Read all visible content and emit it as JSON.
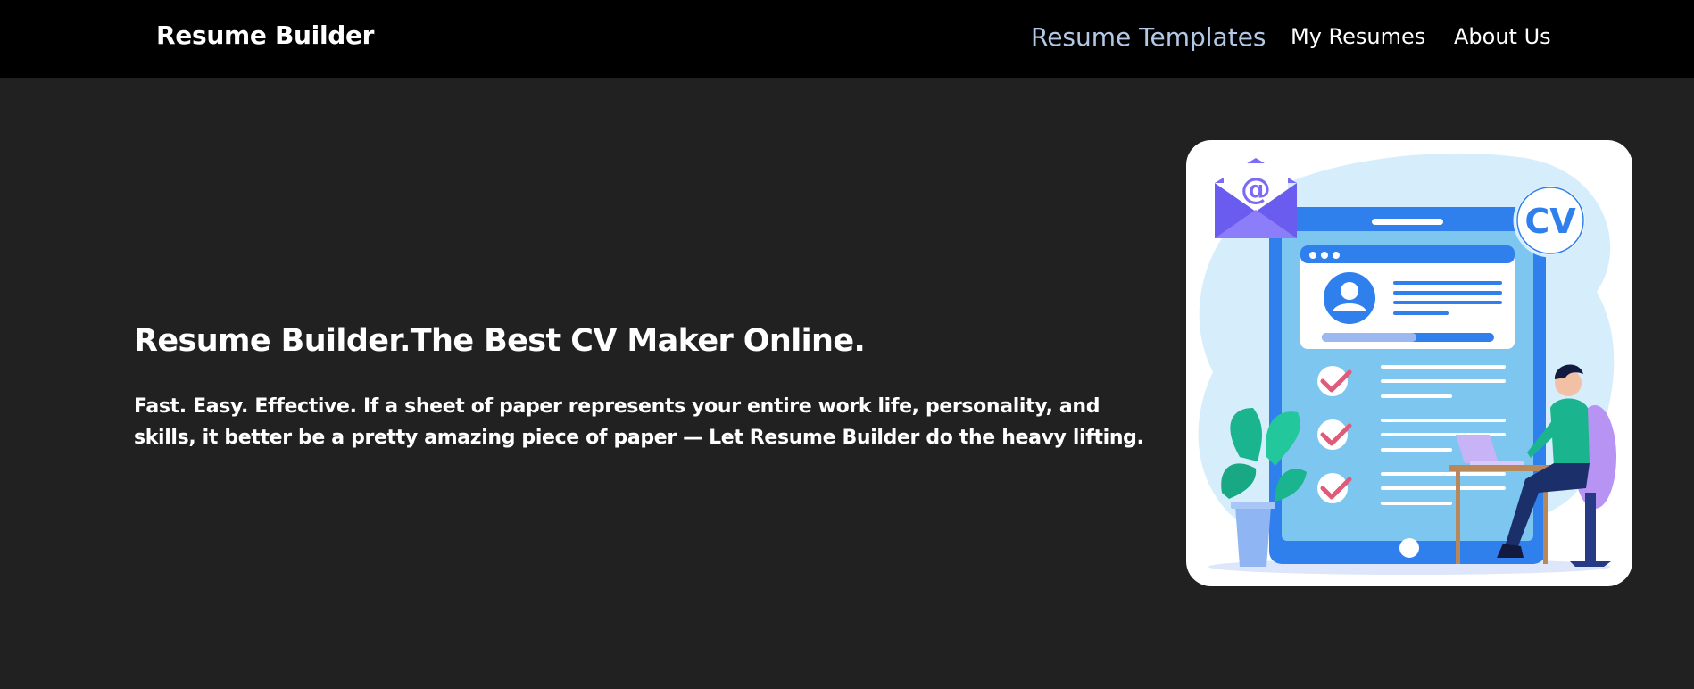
{
  "header": {
    "brand": "Resume Builder",
    "nav": [
      {
        "label": "Resume Templates",
        "active": true
      },
      {
        "label": "My Resumes"
      },
      {
        "label": "About Us"
      }
    ]
  },
  "hero": {
    "title": "Resume Builder.The Best CV Maker Online.",
    "description": "Fast. Easy. Effective. If a sheet of paper represents your entire work life, personality, and skills, it better be a pretty amazing piece of paper — Let Resume Builder do the heavy lifting.",
    "illustration": {
      "badge": "CV",
      "envelope_symbol": "@"
    }
  },
  "colors": {
    "background": "#212121",
    "topbar": "#000000",
    "active_nav": "#b3c7e6",
    "accent_blue": "#2f80ed",
    "check": "#e05a7a"
  }
}
